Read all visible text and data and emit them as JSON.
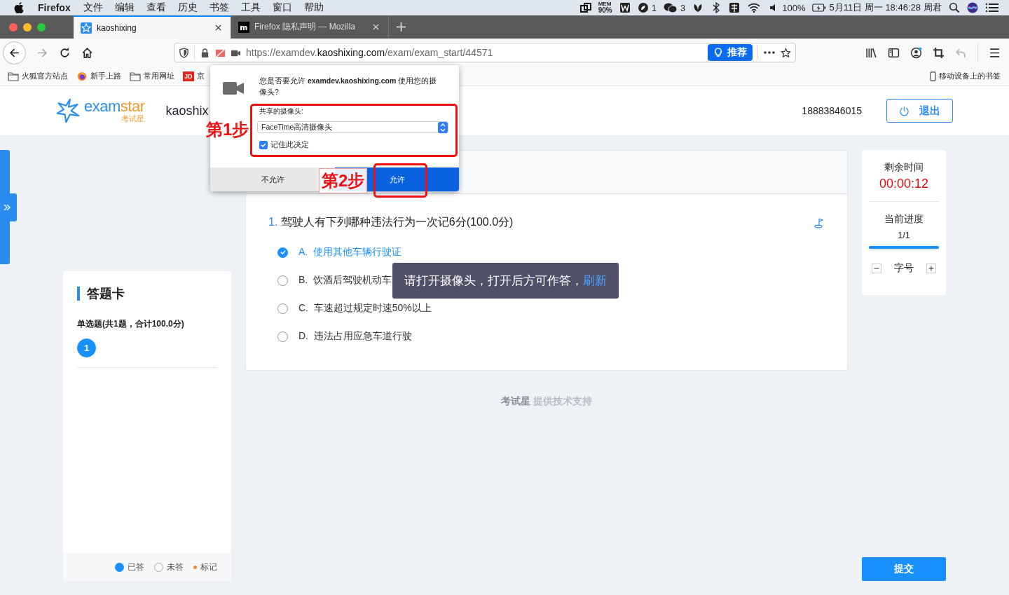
{
  "menubar": {
    "app": "Firefox",
    "menus": [
      "文件",
      "编辑",
      "查看",
      "历史",
      "书签",
      "工具",
      "窗口",
      "帮助"
    ],
    "status": {
      "mem_label": "MEM",
      "mem_value": "90%",
      "notice_count": "1",
      "chat_count": "3",
      "battery": "100%",
      "clock": "5月11日 周一 18:46:28",
      "user": "周君"
    }
  },
  "tabs": [
    {
      "title": "kaoshixing",
      "selected": true,
      "kind": "site"
    },
    {
      "title": "Firefox 隐私声明 — Mozilla",
      "selected": false,
      "kind": "mozilla"
    }
  ],
  "toolbar": {
    "url": {
      "scheme": "https://examdev.",
      "host": "kaoshixing.com",
      "path": "/exam/exam_start/44571"
    },
    "recommend_button": "推荐"
  },
  "bookmarks": {
    "items": [
      {
        "label": "火狐官方站点",
        "kind": "folder"
      },
      {
        "label": "新手上路",
        "kind": "firefox"
      },
      {
        "label": "常用网址",
        "kind": "folder"
      },
      {
        "label": "京",
        "kind": "jd",
        "icon_text": "JD"
      }
    ],
    "mobile": "移动设备上的书签"
  },
  "site_header": {
    "logo": {
      "word_a": "exam",
      "word_b": "star",
      "sub": "考试星"
    },
    "site_name": "kaoshix",
    "phone": "18883846015",
    "logout_button": "退出"
  },
  "question": {
    "number": "1.",
    "text": "驾驶人有下列哪种违法行为一次记6分(100.0分)",
    "options": [
      {
        "letter": "A.",
        "text": "使用其他车辆行驶证",
        "selected": true
      },
      {
        "letter": "B.",
        "text": "饮酒后驾驶机动车",
        "selected": false
      },
      {
        "letter": "C.",
        "text": "车速超过规定时速50%以上",
        "selected": false
      },
      {
        "letter": "D.",
        "text": "违法占用应急车道行驶",
        "selected": false
      }
    ]
  },
  "toast": {
    "message": "请打开摄像头，打开后方可作答，",
    "link": "刷新"
  },
  "answer_card": {
    "title": "答题卡",
    "section": "单选题(共1题，合计100.0分)",
    "items": [
      {
        "label": "1",
        "answered": true
      }
    ],
    "legend": [
      {
        "label": "已答",
        "kind": "answered"
      },
      {
        "label": "未答",
        "kind": "unanswered"
      },
      {
        "label": "标记",
        "kind": "marked"
      }
    ]
  },
  "footer": {
    "brand": "考试星",
    "text": "提供技术支持"
  },
  "side_panel": {
    "time_label": "剩余时间",
    "time": "00:00:12",
    "progress_label": "当前进度",
    "progress_text": "1/1",
    "level": 1,
    "font_label": "字号"
  },
  "submit_button": "提交",
  "permission_popup": {
    "message": "您是否要允许 **examdev.kaoshixing.com** 使用您的摄像头?",
    "camera_label": "共享的摄像头:",
    "camera_select": "FaceTime高清摄像头",
    "remember": {
      "label": "记住此决定",
      "checked": true
    },
    "deny_button": "不允许",
    "allow_button": "允许"
  },
  "annotations": [
    {
      "label": "第1步"
    },
    {
      "label": "第2步"
    }
  ]
}
